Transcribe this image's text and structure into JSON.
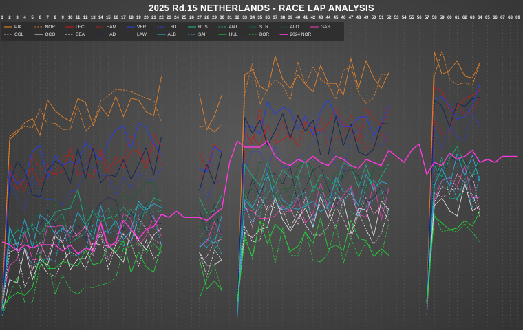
{
  "chart_data": {
    "type": "line",
    "title": "2025 Rd.15 NETHERLANDS - RACE LAP ANALYSIS",
    "xlabel": "",
    "ylabel": "",
    "x_ticks": [
      1,
      2,
      3,
      4,
      5,
      6,
      7,
      8,
      9,
      10,
      11,
      12,
      13,
      14,
      15,
      16,
      17,
      18,
      19,
      20,
      21,
      22,
      23,
      24,
      25,
      26,
      27,
      28,
      29,
      30,
      31,
      32,
      33,
      34,
      35,
      36,
      37,
      38,
      39,
      40,
      41,
      42,
      43,
      44,
      45,
      46,
      47,
      48,
      49,
      50,
      51,
      52,
      53,
      54,
      55,
      56,
      57,
      58,
      59,
      60,
      61,
      62,
      63,
      64,
      65,
      66,
      67,
      68,
      69,
      70,
      71,
      72
    ],
    "xlim": [
      1,
      69.5
    ],
    "ylim": [
      0,
      100
    ],
    "y_axis_shown": false,
    "grid": true,
    "legend_position": "top-left",
    "series": [
      {
        "name": "PIA",
        "color": "#e8832a",
        "dash": "solid",
        "width": 0.9
      },
      {
        "name": "NOR",
        "color": "#e8832a",
        "dash": "dashed",
        "width": 0.9
      },
      {
        "name": "LEC",
        "color": "#c41a1a",
        "dash": "solid",
        "width": 0.9
      },
      {
        "name": "HAM",
        "color": "#c41a1a",
        "dash": "dashed",
        "width": 0.9
      },
      {
        "name": "VER",
        "color": "#2b3fd6",
        "dash": "solid",
        "width": 1.2
      },
      {
        "name": "TSU",
        "color": "#2b3fd6",
        "dash": "dashed",
        "width": 0.9
      },
      {
        "name": "RUS",
        "color": "#1fae86",
        "dash": "solid",
        "width": 0.9
      },
      {
        "name": "ANT",
        "color": "#1fae86",
        "dash": "dashed",
        "width": 0.9
      },
      {
        "name": "STR",
        "color": "#1d5e3a",
        "dash": "solid",
        "width": 0.9
      },
      {
        "name": "ALO",
        "color": "#1d5e3a",
        "dash": "dashed",
        "width": 0.9
      },
      {
        "name": "GAS",
        "color": "#e040b0",
        "dash": "solid",
        "width": 0.9
      },
      {
        "name": "COL",
        "color": "#e89ad8",
        "dash": "dashed",
        "width": 0.9
      },
      {
        "name": "OCO",
        "color": "#dddddd",
        "dash": "solid",
        "width": 0.9
      },
      {
        "name": "BEA",
        "color": "#dddddd",
        "dash": "dashed",
        "width": 0.9
      },
      {
        "name": "HAD",
        "color": "#1a2a55",
        "dash": "solid",
        "width": 1.1
      },
      {
        "name": "LAW",
        "color": "#1a2a55",
        "dash": "dashed",
        "width": 0.9
      },
      {
        "name": "ALB",
        "color": "#2aa8d8",
        "dash": "solid",
        "width": 0.9
      },
      {
        "name": "SAI",
        "color": "#2aa8d8",
        "dash": "dashed",
        "width": 0.9
      },
      {
        "name": "HUL",
        "color": "#22d33a",
        "dash": "solid",
        "width": 0.9
      },
      {
        "name": "BOR",
        "color": "#22d33a",
        "dash": "dashed",
        "width": 0.9
      },
      {
        "name": "2024 NOR",
        "color": "#ff3ae0",
        "dash": "solid",
        "width": 1.4
      }
    ]
  }
}
